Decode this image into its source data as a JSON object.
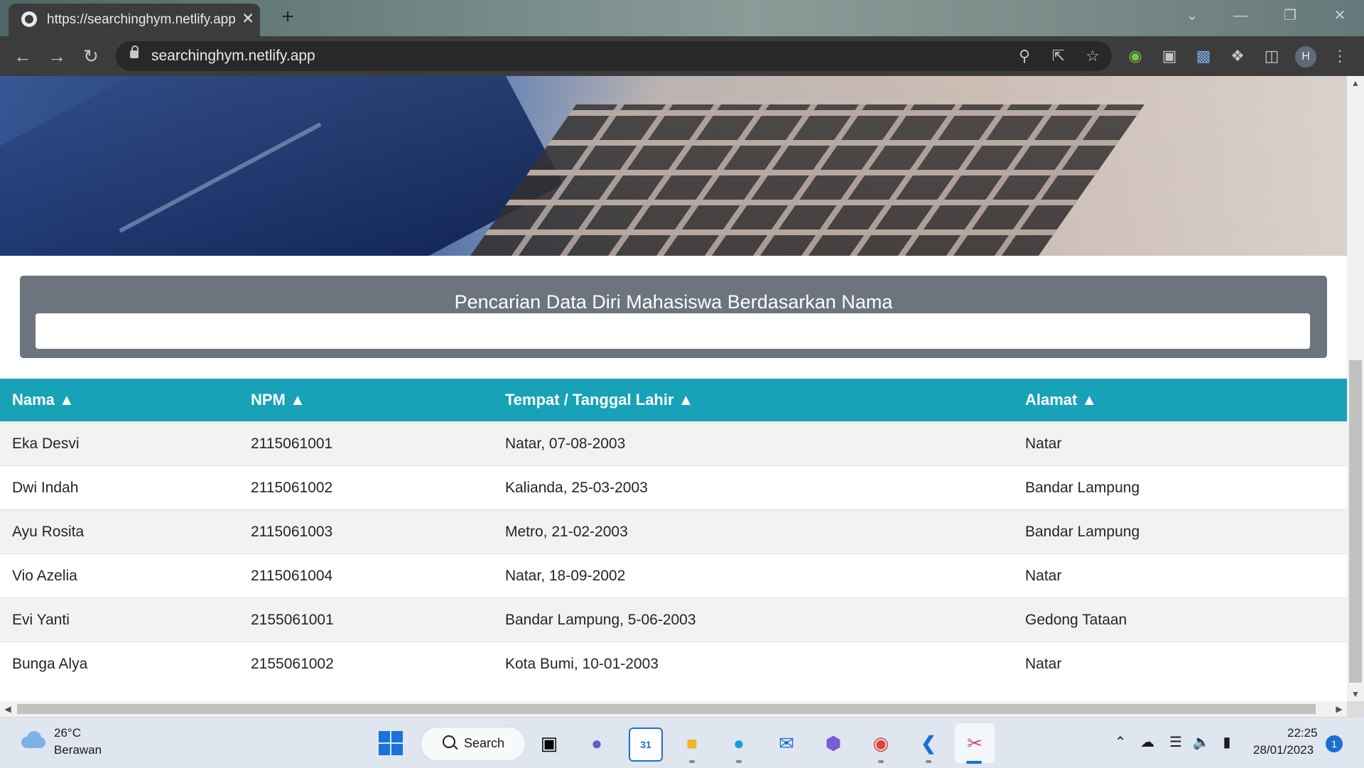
{
  "browser": {
    "tab_title": "https://searchinghym.netlify.app",
    "tab_close": "✕",
    "new_tab": "+",
    "url": "searchinghym.netlify.app",
    "profile_initial": "H",
    "window_controls": [
      "minimize",
      "restore",
      "close"
    ]
  },
  "page": {
    "search_heading": "Pencarian Data Diri Mahasiswa Berdasarkan Nama",
    "search_value": "",
    "table": {
      "headers": [
        "Nama ▲",
        "NPM ▲",
        "Tempat / Tanggal Lahir ▲",
        "Alamat ▲"
      ],
      "rows": [
        [
          "Eka Desvi",
          "2115061001",
          "Natar, 07-08-2003",
          "Natar"
        ],
        [
          "Dwi Indah",
          "2115061002",
          "Kalianda, 25-03-2003",
          "Bandar Lampung"
        ],
        [
          "Ayu Rosita",
          "2115061003",
          "Metro, 21-02-2003",
          "Bandar Lampung"
        ],
        [
          "Vio Azelia",
          "2115061004",
          "Natar, 18-09-2002",
          "Natar"
        ],
        [
          "Evi Yanti",
          "2155061001",
          "Bandar Lampung, 5-06-2003",
          "Gedong Tataan"
        ],
        [
          "Bunga Alya",
          "2155061002",
          "Kota Bumi, 10-01-2003",
          "Natar"
        ]
      ]
    }
  },
  "taskbar": {
    "weather_temp": "26°C",
    "weather_desc": "Berawan",
    "search_label": "Search",
    "calendar_day": "31",
    "chrome_badge": "H",
    "clock_time": "22:25",
    "clock_date": "28/01/2023",
    "notification_count": "1"
  },
  "colors": {
    "table_header": "#17a2b8",
    "search_panel": "#6c757d",
    "browser_toolbar": "#3c3c3c",
    "taskbar": "#dfe6ef",
    "accent_blue": "#1a6fd1"
  }
}
